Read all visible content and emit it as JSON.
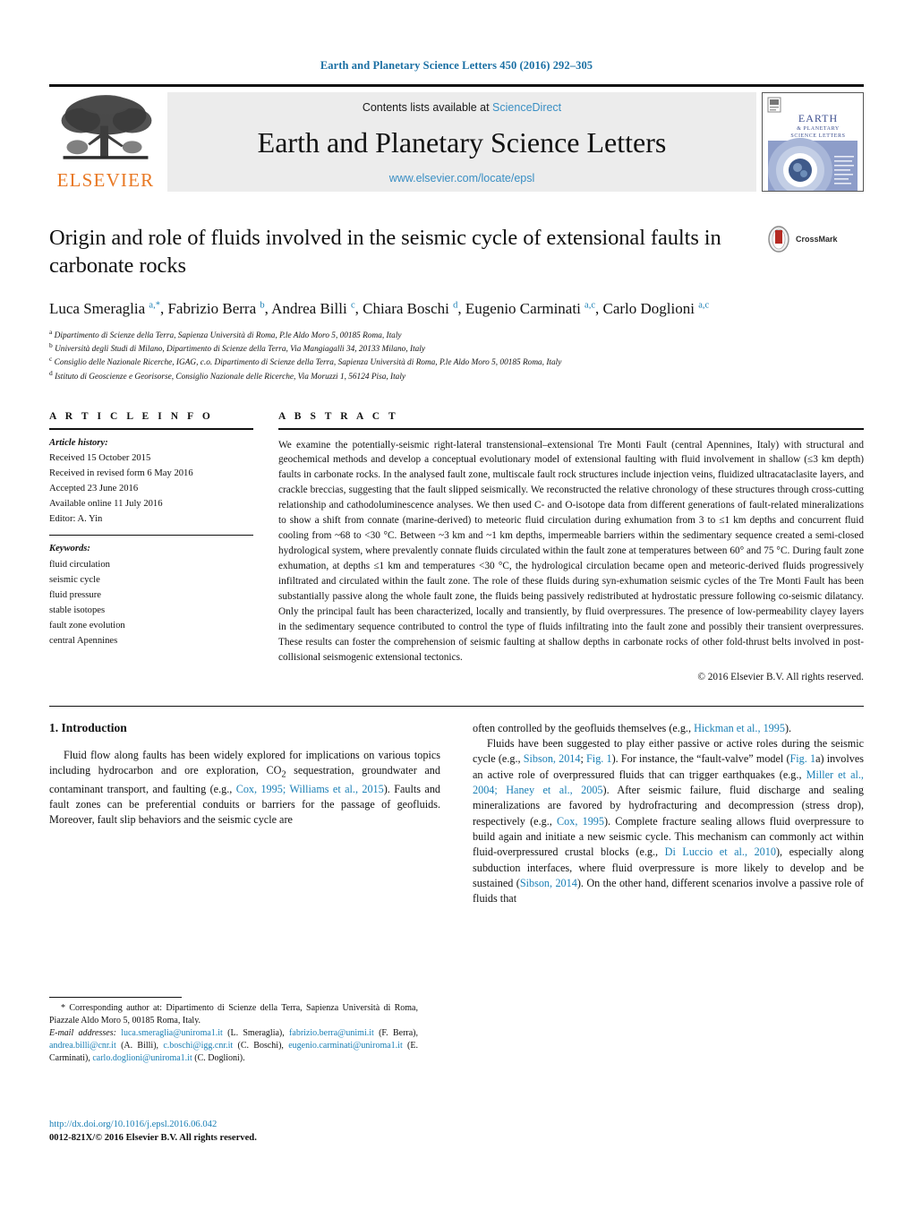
{
  "running_head": "Earth and Planetary Science Letters 450 (2016) 292–305",
  "masthead": {
    "publisher_name": "ELSEVIER",
    "contents_prefix": "Contents lists available at ",
    "contents_link": "ScienceDirect",
    "journal_title": "Earth and Planetary Science Letters",
    "journal_url": "www.elsevier.com/locate/epsl",
    "cover_title_line1": "EARTH",
    "cover_title_line2": "& PLANETARY",
    "cover_title_line3": "SCIENCE LETTERS"
  },
  "article": {
    "title": "Origin and role of fluids involved in the seismic cycle of extensional faults in carbonate rocks",
    "crossmark_label": "CrossMark",
    "authors_html": "Luca Smeraglia <sup>a,*</sup>, Fabrizio Berra <sup>b</sup>, Andrea Billi <sup>c</sup>, Chiara Boschi <sup>d</sup>, Eugenio Carminati <sup>a,c</sup>, Carlo Doglioni <sup>a,c</sup>",
    "affiliations": [
      {
        "marker": "a",
        "text": "Dipartimento di Scienze della Terra, Sapienza Università di Roma, P.le Aldo Moro 5, 00185 Roma, Italy"
      },
      {
        "marker": "b",
        "text": "Università degli Studi di Milano, Dipartimento di Scienze della Terra, Via Mangiagalli 34, 20133 Milano, Italy"
      },
      {
        "marker": "c",
        "text": "Consiglio delle Nazionale Ricerche, IGAG, c.o. Dipartimento di Scienze della Terra, Sapienza Università di Roma, P.le Aldo Moro 5, 00185 Roma, Italy"
      },
      {
        "marker": "d",
        "text": "Istituto di Geoscienze e Georisorse, Consiglio Nazionale delle Ricerche, Via Moruzzi 1, 56124 Pisa, Italy"
      }
    ]
  },
  "article_info": {
    "heading": "A R T I C L E   I N F O",
    "history_label": "Article history:",
    "history": [
      "Received 15 October 2015",
      "Received in revised form 6 May 2016",
      "Accepted 23 June 2016",
      "Available online 11 July 2016",
      "Editor: A. Yin"
    ],
    "keywords_label": "Keywords:",
    "keywords": [
      "fluid circulation",
      "seismic cycle",
      "fluid pressure",
      "stable isotopes",
      "fault zone evolution",
      "central Apennines"
    ]
  },
  "abstract": {
    "heading": "A B S T R A C T",
    "text": "We examine the potentially-seismic right-lateral transtensional–extensional Tre Monti Fault (central Apennines, Italy) with structural and geochemical methods and develop a conceptual evolutionary model of extensional faulting with fluid involvement in shallow (≤3 km depth) faults in carbonate rocks. In the analysed fault zone, multiscale fault rock structures include injection veins, fluidized ultracataclasite layers, and crackle breccias, suggesting that the fault slipped seismically. We reconstructed the relative chronology of these structures through cross-cutting relationship and cathodoluminescence analyses. We then used C- and O-isotope data from different generations of fault-related mineralizations to show a shift from connate (marine-derived) to meteoric fluid circulation during exhumation from 3 to ≤1 km depths and concurrent fluid cooling from ~68 to <30 °C. Between ~3 km and ~1 km depths, impermeable barriers within the sedimentary sequence created a semi-closed hydrological system, where prevalently connate fluids circulated within the fault zone at temperatures between 60° and 75 °C. During fault zone exhumation, at depths ≤1 km and temperatures <30 °C, the hydrological circulation became open and meteoric-derived fluids progressively infiltrated and circulated within the fault zone. The role of these fluids during syn-exhumation seismic cycles of the Tre Monti Fault has been substantially passive along the whole fault zone, the fluids being passively redistributed at hydrostatic pressure following co-seismic dilatancy. Only the principal fault has been characterized, locally and transiently, by fluid overpressures. The presence of low-permeability clayey layers in the sedimentary sequence contributed to control the type of fluids infiltrating into the fault zone and possibly their transient overpressures. These results can foster the comprehension of seismic faulting at shallow depths in carbonate rocks of other fold-thrust belts involved in post-collisional seismogenic extensional tectonics.",
    "copyright": "© 2016 Elsevier B.V. All rights reserved."
  },
  "body": {
    "section_title": "1. Introduction",
    "left_para_1_pre": "Fluid flow along faults has been widely explored for implications on various topics including hydrocarbon and ore exploration, CO",
    "left_para_1_sub": "2",
    "left_para_1_mid": " sequestration, groundwater and contaminant transport, and faulting (e.g., ",
    "left_ref_1": "Cox, 1995; Williams et al., 2015",
    "left_para_1_post": "). Faults and fault zones can be preferential conduits or barriers for the passage of geofluids. Moreover, fault slip behaviors and the seismic cycle are",
    "right_para_0_pre": "often controlled by the geofluids themselves (e.g., ",
    "right_ref_0": "Hickman et al., 1995",
    "right_para_0_post": ").",
    "right_para_1_a": "Fluids have been suggested to play either passive or active roles during the seismic cycle (e.g., ",
    "right_ref_1": "Sibson, 2014",
    "right_para_1_b": "; ",
    "right_ref_2": "Fig. 1",
    "right_para_1_c": "). For instance, the “fault-valve” model (",
    "right_ref_3": "Fig. 1",
    "right_para_1_d": "a) involves an active role of overpressured fluids that can trigger earthquakes (e.g., ",
    "right_ref_4": "Miller et al., 2004; Haney et al., 2005",
    "right_para_1_e": "). After seismic failure, fluid discharge and sealing mineralizations are favored by hydrofracturing and decompression (stress drop), respectively (e.g., ",
    "right_ref_5": "Cox, 1995",
    "right_para_1_f": "). Complete fracture sealing allows fluid overpressure to build again and initiate a new seismic cycle. This mechanism can commonly act within fluid-overpressured crustal blocks (e.g., ",
    "right_ref_6": "Di Luccio et al., 2010",
    "right_para_1_g": "), especially along subduction interfaces, where fluid overpressure is more likely to develop and be sustained (",
    "right_ref_7": "Sibson, 2014",
    "right_para_1_h": "). On the other hand, different scenarios involve a passive role of fluids that"
  },
  "footnotes": {
    "corresponding_marker": "*",
    "corresponding_text": "Corresponding author at: Dipartimento di Scienze della Terra, Sapienza Università di Roma, Piazzale Aldo Moro 5, 00185 Roma, Italy.",
    "emails_label": "E-mail addresses:",
    "emails": [
      {
        "address": "luca.smeraglia@uniroma1.it",
        "person": "(L. Smeraglia),"
      },
      {
        "address": "fabrizio.berra@unimi.it",
        "person": "(F. Berra),"
      },
      {
        "address": "andrea.billi@cnr.it",
        "person": "(A. Billi),"
      },
      {
        "address": "c.boschi@igg.cnr.it",
        "person": "(C. Boschi),"
      },
      {
        "address": "eugenio.carminati@uniroma1.it",
        "person": "(E. Carminati),"
      },
      {
        "address": "carlo.doglioni@uniroma1.it",
        "person": "(C. Doglioni)."
      }
    ],
    "doi": "http://dx.doi.org/10.1016/j.epsl.2016.06.042",
    "issn_line": "0012-821X/© 2016 Elsevier B.V. All rights reserved."
  },
  "colors": {
    "link_blue": "#1a7fb5",
    "header_blue": "#1a6fa3",
    "elsevier_orange": "#E87722",
    "masthead_gray": "#ececec"
  }
}
